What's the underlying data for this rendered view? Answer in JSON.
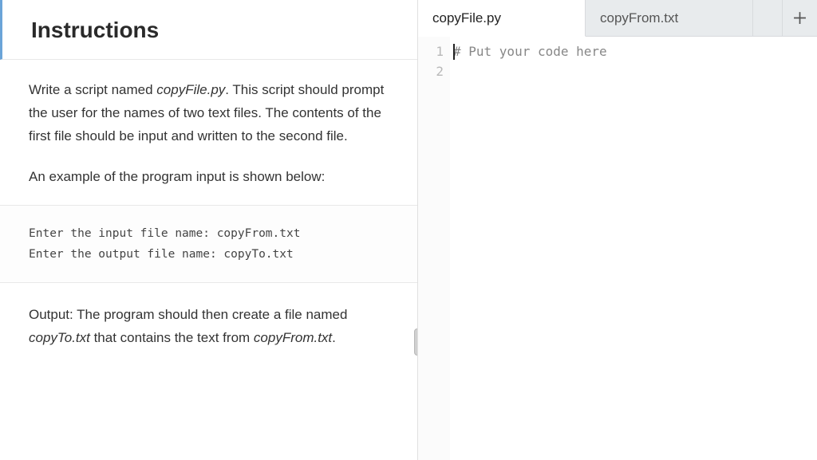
{
  "instructions": {
    "title": "Instructions",
    "para1_pre": "Write a script named ",
    "para1_italic": "copyFile.py",
    "para1_post": ". This script should prompt the user for the names of two text files. The contents of the first file should be input and written to the second file.",
    "para2": "An example of the program input is shown below:",
    "code_sample": "Enter the input file name: copyFrom.txt\nEnter the output file name: copyTo.txt",
    "output_pre": "Output: The program should then create a file named ",
    "output_italic1": "copyTo.txt",
    "output_mid": " that contains the text from ",
    "output_italic2": "copyFrom.txt",
    "output_post": "."
  },
  "tabs": {
    "active": "copyFile.py",
    "inactive": "copyFrom.txt"
  },
  "editor": {
    "line1_num": "1",
    "line2_num": "2",
    "line1_content": "# Put your code here"
  }
}
